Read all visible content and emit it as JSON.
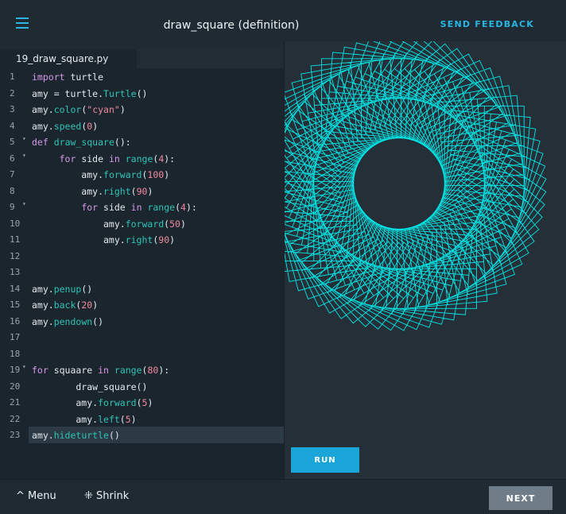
{
  "header": {
    "title": "draw_square (definition)",
    "feedback_label": "SEND FEEDBACK"
  },
  "editor": {
    "tab_label": "19_draw_square.py",
    "active_line": 23,
    "lines": [
      {
        "n": "1",
        "fold": "",
        "html": "<span class=\"k\">import</span> turtle"
      },
      {
        "n": "2",
        "fold": "",
        "html": "amy = turtle.<span class=\"f\">Turtle</span>()"
      },
      {
        "n": "3",
        "fold": "",
        "html": "amy.<span class=\"f\">color</span>(<span class=\"s\">\"cyan\"</span>)"
      },
      {
        "n": "4",
        "fold": "",
        "html": "amy.<span class=\"f\">speed</span>(<span class=\"n\">0</span>)"
      },
      {
        "n": "5",
        "fold": "▾",
        "html": "<span class=\"k\">def</span> <span class=\"f\">draw_square</span>():"
      },
      {
        "n": "6",
        "fold": "▾",
        "html": "     <span class=\"k\">for</span> side <span class=\"k\">in</span> <span class=\"f\">range</span>(<span class=\"n\">4</span>):"
      },
      {
        "n": "7",
        "fold": "",
        "html": "         amy.<span class=\"f\">forward</span>(<span class=\"n\">100</span>)"
      },
      {
        "n": "8",
        "fold": "",
        "html": "         amy.<span class=\"f\">right</span>(<span class=\"n\">90</span>)"
      },
      {
        "n": "9",
        "fold": "▾",
        "html": "         <span class=\"k\">for</span> side <span class=\"k\">in</span> <span class=\"f\">range</span>(<span class=\"n\">4</span>):"
      },
      {
        "n": "10",
        "fold": "",
        "html": "             amy.<span class=\"f\">forward</span>(<span class=\"n\">50</span>)"
      },
      {
        "n": "11",
        "fold": "",
        "html": "             amy.<span class=\"f\">right</span>(<span class=\"n\">90</span>)"
      },
      {
        "n": "12",
        "fold": "",
        "html": ""
      },
      {
        "n": "13",
        "fold": "",
        "html": ""
      },
      {
        "n": "14",
        "fold": "",
        "html": "amy.<span class=\"f\">penup</span>()"
      },
      {
        "n": "15",
        "fold": "",
        "html": "amy.<span class=\"f\">back</span>(<span class=\"n\">20</span>)"
      },
      {
        "n": "16",
        "fold": "",
        "html": "amy.<span class=\"f\">pendown</span>()"
      },
      {
        "n": "17",
        "fold": "",
        "html": ""
      },
      {
        "n": "18",
        "fold": "",
        "html": ""
      },
      {
        "n": "19",
        "fold": "▾",
        "html": "<span class=\"k\">for</span> squaare <span class=\"k\">in</span> <span class=\"f\">range</span>(<span class=\"n\">80</span>):"
      },
      {
        "n": "20",
        "fold": "",
        "html": "        draw_square()"
      },
      {
        "n": "21",
        "fold": "",
        "html": "        amy.<span class=\"f\">forward</span>(<span class=\"n\">5</span>)"
      },
      {
        "n": "22",
        "fold": "",
        "html": "        amy.<span class=\"f\">left</span>(<span class=\"n\">5</span>)"
      },
      {
        "n": "23",
        "fold": "",
        "html": "amy.<span class=\"f\">hideturtle</span>()"
      }
    ]
  },
  "canvas": {
    "turtle_color": "#00e5e5",
    "repetitions": 80,
    "square_side": 100,
    "inner_side": 50,
    "step_forward": 5,
    "turn_degrees": 5
  },
  "actions": {
    "run_label": "RUN",
    "next_label": "NEXT"
  },
  "footer": {
    "menu_label": "Menu",
    "shrink_label": "Shrink"
  },
  "colors": {
    "accent": "#29b5e3",
    "run_button": "#1aa5d9",
    "next_button": "#6f7d89"
  }
}
